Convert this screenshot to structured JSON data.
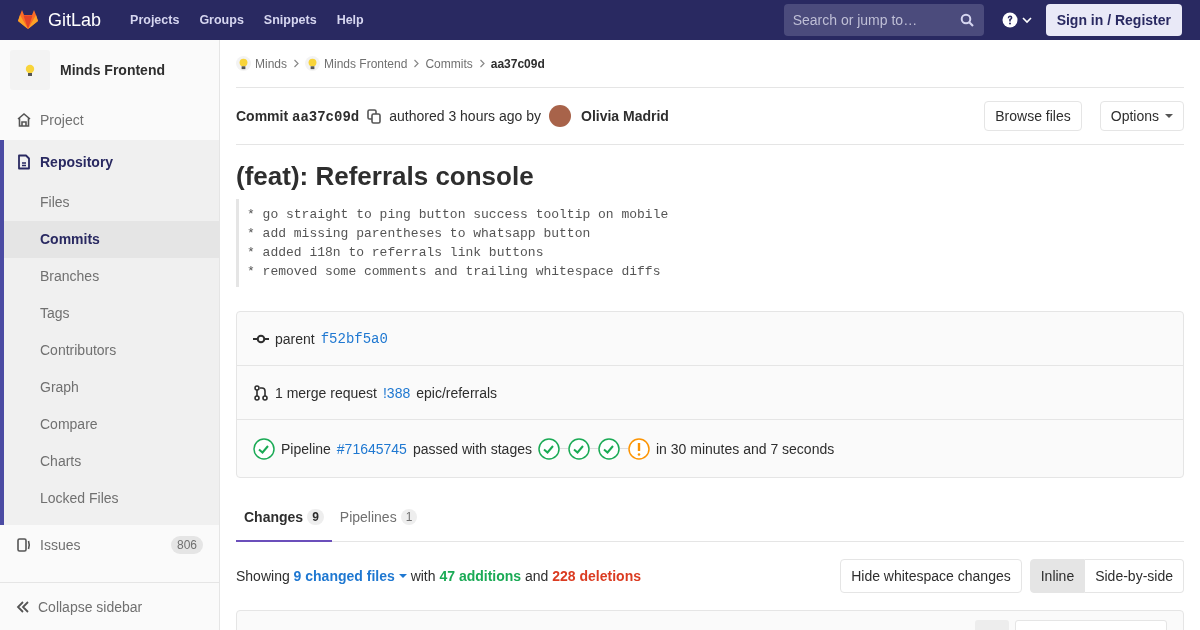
{
  "header": {
    "logo": "GitLab",
    "nav": [
      {
        "label": "Projects"
      },
      {
        "label": "Groups"
      },
      {
        "label": "Snippets"
      },
      {
        "label": "Help"
      }
    ],
    "search": {
      "placeholder": "Search or jump to…"
    },
    "sign_in": "Sign in / Register"
  },
  "sidebar": {
    "project": "Minds Frontend",
    "items": [
      {
        "label": "Project",
        "kind": "home",
        "selected": false
      },
      {
        "label": "Repository",
        "kind": "repo",
        "selected": true,
        "expanded": true,
        "children": [
          {
            "label": "Files",
            "selected": false
          },
          {
            "label": "Commits",
            "selected": true
          },
          {
            "label": "Branches",
            "selected": false
          },
          {
            "label": "Tags",
            "selected": false
          },
          {
            "label": "Contributors",
            "selected": false
          },
          {
            "label": "Graph",
            "selected": false
          },
          {
            "label": "Compare",
            "selected": false
          },
          {
            "label": "Charts",
            "selected": false
          },
          {
            "label": "Locked Files",
            "selected": false
          }
        ]
      },
      {
        "label": "Issues",
        "kind": "issues",
        "selected": false,
        "count": "806"
      }
    ],
    "collapse": "Collapse sidebar"
  },
  "breadcrumbs": [
    {
      "label": "Minds",
      "avatar": true
    },
    {
      "label": "Minds Frontend",
      "avatar": true
    },
    {
      "label": "Commits",
      "avatar": false
    },
    {
      "label": "aa37c09d",
      "avatar": false
    }
  ],
  "commit": {
    "label": "Commit",
    "sha": "aa37c09d",
    "authored": "authored 3 hours ago by",
    "author": "Olivia Madrid",
    "browse": "Browse files",
    "options": "Options",
    "title": "(feat): Referrals console",
    "message": [
      "* go straight to ping button success tooltip on mobile",
      "* add missing parentheses to whatsapp button",
      "* added i18n to referrals link buttons",
      "* removed some comments and trailing whitespace diffs"
    ]
  },
  "info": {
    "parent_label": "parent",
    "parent_sha": "f52bf5a0",
    "mr_text": "1 merge request",
    "mr_link": "!388",
    "mr_branch": "epic/referrals",
    "pipeline_icon": {
      "kind": "success"
    },
    "pipeline_label": "Pipeline",
    "pipeline_link": "#71645745",
    "pipeline_text": "passed with stages",
    "stages": [
      {
        "kind": "success"
      },
      {
        "kind": "success"
      },
      {
        "kind": "success"
      },
      {
        "kind": "warning"
      }
    ],
    "duration": "in 30 minutes and 7 seconds"
  },
  "tabs": [
    {
      "label": "Changes",
      "count": "9",
      "selected": true
    },
    {
      "label": "Pipelines",
      "count": "1",
      "selected": false
    }
  ],
  "summary": {
    "showing": "Showing",
    "files": "9 changed files",
    "with": "with",
    "additions": "47 additions",
    "and": "and",
    "deletions": "228 deletions"
  },
  "whitespace_button": "Hide whitespace changes",
  "view_modes": [
    {
      "label": "Inline",
      "selected": true
    },
    {
      "label": "Side-by-side",
      "selected": false
    }
  ]
}
